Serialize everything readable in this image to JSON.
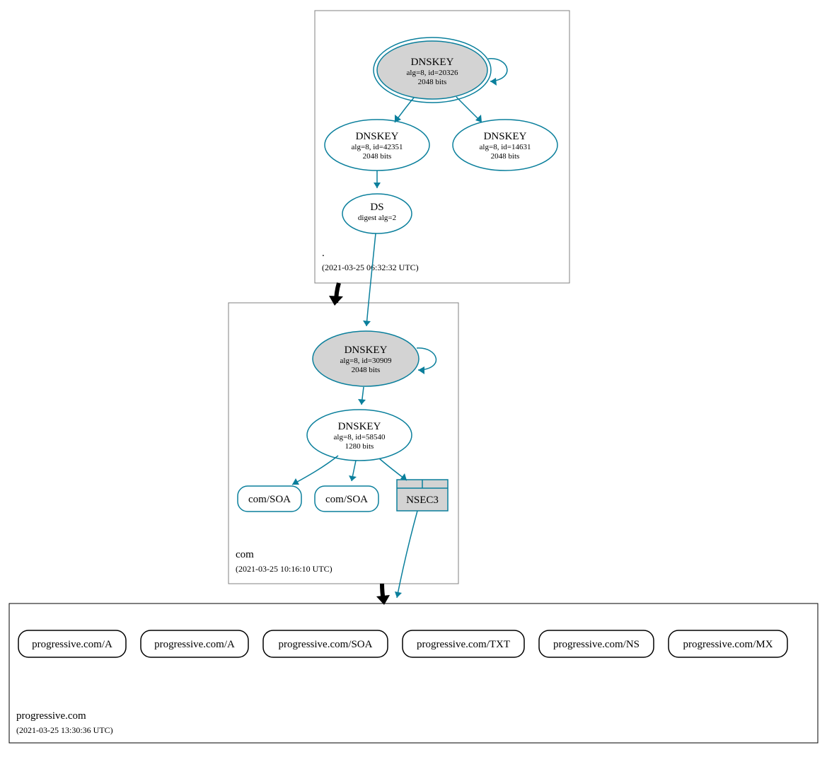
{
  "colors": {
    "teal": "#0a7f9c",
    "fill_gray": "#d3d3d3"
  },
  "zones": {
    "root": {
      "name": ".",
      "timestamp": "(2021-03-25 06:32:32 UTC)",
      "keys": {
        "ksk": {
          "title": "DNSKEY",
          "line1": "alg=8, id=20326",
          "line2": "2048 bits"
        },
        "zsk1": {
          "title": "DNSKEY",
          "line1": "alg=8, id=42351",
          "line2": "2048 bits"
        },
        "zsk2": {
          "title": "DNSKEY",
          "line1": "alg=8, id=14631",
          "line2": "2048 bits"
        }
      },
      "ds": {
        "title": "DS",
        "line1": "digest alg=2"
      }
    },
    "com": {
      "name": "com",
      "timestamp": "(2021-03-25 10:16:10 UTC)",
      "keys": {
        "ksk": {
          "title": "DNSKEY",
          "line1": "alg=8, id=30909",
          "line2": "2048 bits"
        },
        "zsk": {
          "title": "DNSKEY",
          "line1": "alg=8, id=58540",
          "line2": "1280 bits"
        }
      },
      "rr1": "com/SOA",
      "rr2": "com/SOA",
      "nsec3": "NSEC3"
    },
    "progressive": {
      "name": "progressive.com",
      "timestamp": "(2021-03-25 13:30:36 UTC)",
      "rrs": [
        "progressive.com/A",
        "progressive.com/A",
        "progressive.com/SOA",
        "progressive.com/TXT",
        "progressive.com/NS",
        "progressive.com/MX"
      ]
    }
  }
}
